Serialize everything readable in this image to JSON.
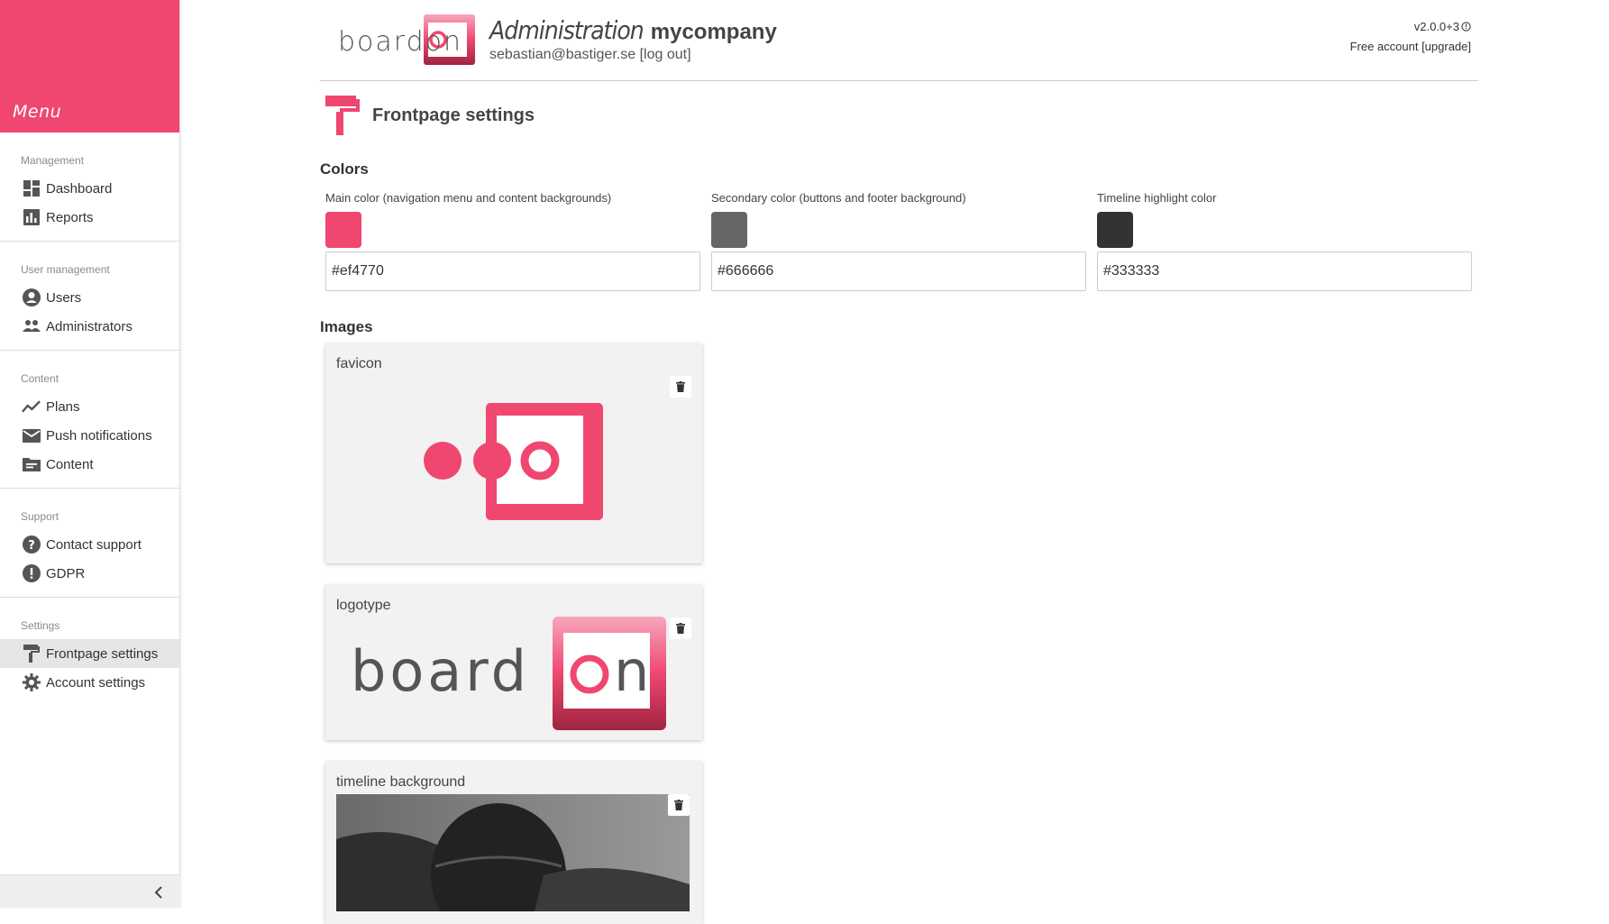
{
  "sidebar": {
    "menu_title": "Menu",
    "sections": [
      {
        "label": "Management",
        "items": [
          {
            "label": "Dashboard",
            "icon": "dashboard-icon"
          },
          {
            "label": "Reports",
            "icon": "reports-icon"
          }
        ]
      },
      {
        "label": "User management",
        "items": [
          {
            "label": "Users",
            "icon": "user-icon"
          },
          {
            "label": "Administrators",
            "icon": "group-icon"
          }
        ]
      },
      {
        "label": "Content",
        "items": [
          {
            "label": "Plans",
            "icon": "trend-icon"
          },
          {
            "label": "Push notifications",
            "icon": "mail-icon"
          },
          {
            "label": "Content",
            "icon": "folder-icon"
          }
        ]
      },
      {
        "label": "Support",
        "items": [
          {
            "label": "Contact support",
            "icon": "help-icon"
          },
          {
            "label": "GDPR",
            "icon": "alert-icon"
          }
        ]
      },
      {
        "label": "Settings",
        "items": [
          {
            "label": "Frontpage settings",
            "icon": "paint-roller-icon",
            "active": true
          },
          {
            "label": "Account settings",
            "icon": "gear-icon"
          }
        ]
      }
    ]
  },
  "header": {
    "brand": "boardon",
    "admin_word": "Administration",
    "company": "mycompany",
    "user_email": "sebastian@bastiger.se",
    "logout_label": "[log out]",
    "version": "v2.0.0+3",
    "account_type": "Free account",
    "upgrade_label": "[upgrade]"
  },
  "page": {
    "title": "Frontpage settings",
    "colors_title": "Colors",
    "colors": [
      {
        "label": "Main color (navigation menu and content backgrounds)",
        "value": "#ef4770",
        "swatch": "#ef4770"
      },
      {
        "label": "Secondary color (buttons and footer background)",
        "value": "#666666",
        "swatch": "#666666"
      },
      {
        "label": "Timeline highlight color",
        "value": "#333333",
        "swatch": "#333333"
      }
    ],
    "images_title": "Images",
    "images": [
      {
        "label": "favicon"
      },
      {
        "label": "logotype"
      },
      {
        "label": "timeline background"
      }
    ]
  },
  "theme": {
    "accent": "#ef4770",
    "accent_dark": "#a0243f"
  }
}
